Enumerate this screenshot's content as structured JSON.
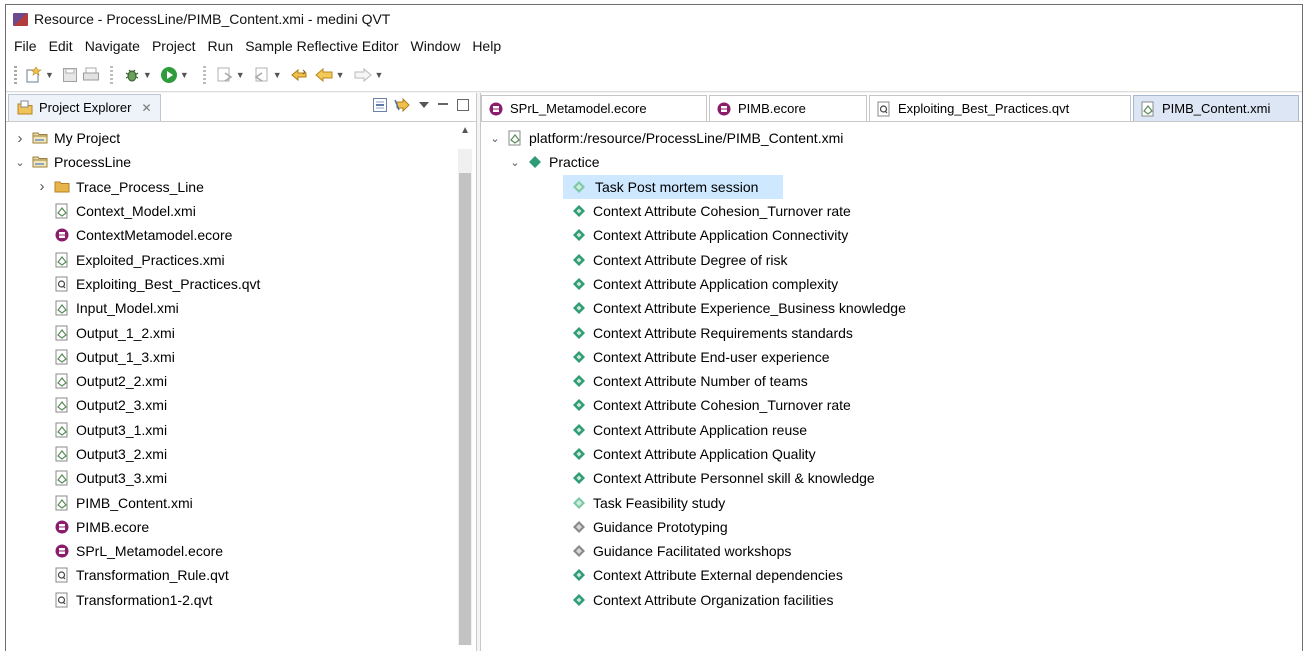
{
  "window": {
    "title": "Resource - ProcessLine/PIMB_Content.xmi - medini QVT"
  },
  "menu": [
    "File",
    "Edit",
    "Navigate",
    "Project",
    "Run",
    "Sample Reflective Editor",
    "Window",
    "Help"
  ],
  "project_explorer": {
    "tab_label": "Project Explorer",
    "tab_close": "⌥",
    "items": [
      {
        "label": "My Project",
        "type": "project",
        "expanded": false,
        "level": 0
      },
      {
        "label": "ProcessLine",
        "type": "project",
        "expanded": true,
        "level": 0
      },
      {
        "label": "Trace_Process_Line",
        "type": "folder",
        "expanded": false,
        "level": 1
      },
      {
        "label": "Context_Model.xmi",
        "type": "xmi",
        "level": 1
      },
      {
        "label": "ContextMetamodel.ecore",
        "type": "ecore",
        "level": 1
      },
      {
        "label": "Exploited_Practices.xmi",
        "type": "xmi",
        "level": 1
      },
      {
        "label": "Exploiting_Best_Practices.qvt",
        "type": "qvt",
        "level": 1
      },
      {
        "label": "Input_Model.xmi",
        "type": "xmi",
        "level": 1
      },
      {
        "label": "Output_1_2.xmi",
        "type": "xmi",
        "level": 1
      },
      {
        "label": "Output_1_3.xmi",
        "type": "xmi",
        "level": 1
      },
      {
        "label": "Output2_2.xmi",
        "type": "xmi",
        "level": 1
      },
      {
        "label": "Output2_3.xmi",
        "type": "xmi",
        "level": 1
      },
      {
        "label": "Output3_1.xmi",
        "type": "xmi",
        "level": 1
      },
      {
        "label": "Output3_2.xmi",
        "type": "xmi",
        "level": 1
      },
      {
        "label": "Output3_3.xmi",
        "type": "xmi",
        "level": 1
      },
      {
        "label": "PIMB_Content.xmi",
        "type": "xmi",
        "level": 1
      },
      {
        "label": "PIMB.ecore",
        "type": "ecore",
        "level": 1
      },
      {
        "label": "SPrL_Metamodel.ecore",
        "type": "ecore",
        "level": 1
      },
      {
        "label": "Transformation_Rule.qvt",
        "type": "qvt",
        "level": 1
      },
      {
        "label": "Transformation1-2.qvt",
        "type": "qvt",
        "level": 1
      }
    ]
  },
  "editor": {
    "tabs": [
      {
        "label": "SPrL_Metamodel.ecore",
        "type": "ecore",
        "active": false
      },
      {
        "label": "PIMB.ecore",
        "type": "ecore",
        "active": false
      },
      {
        "label": "Exploiting_Best_Practices.qvt",
        "type": "qvt",
        "active": false
      },
      {
        "label": "PIMB_Content.xmi",
        "type": "xmi",
        "active": true
      }
    ],
    "resource": "platform:/resource/ProcessLine/PIMB_Content.xmi",
    "root": "Practice",
    "children": [
      {
        "label": "Task Post mortem session",
        "kind": "task",
        "selected": true
      },
      {
        "label": "Context Attribute Cohesion_Turnover rate",
        "kind": "attr"
      },
      {
        "label": "Context Attribute Application Connectivity",
        "kind": "attr"
      },
      {
        "label": "Context Attribute Degree of risk",
        "kind": "attr"
      },
      {
        "label": "Context Attribute Application complexity",
        "kind": "attr"
      },
      {
        "label": "Context Attribute Experience_Business knowledge",
        "kind": "attr"
      },
      {
        "label": "Context Attribute Requirements standards",
        "kind": "attr"
      },
      {
        "label": "Context Attribute End-user experience",
        "kind": "attr"
      },
      {
        "label": "Context Attribute Number of teams",
        "kind": "attr"
      },
      {
        "label": "Context Attribute Cohesion_Turnover rate",
        "kind": "attr"
      },
      {
        "label": "Context Attribute Application reuse",
        "kind": "attr"
      },
      {
        "label": "Context Attribute Application Quality",
        "kind": "attr"
      },
      {
        "label": "Context Attribute Personnel skill & knowledge",
        "kind": "attr"
      },
      {
        "label": "Task Feasibility study",
        "kind": "task"
      },
      {
        "label": "Guidance Prototyping",
        "kind": "guidance"
      },
      {
        "label": "Guidance Facilitated workshops",
        "kind": "guidance"
      },
      {
        "label": "Context Attribute External dependencies",
        "kind": "attr"
      },
      {
        "label": "Context Attribute Organization facilities",
        "kind": "attr"
      }
    ]
  },
  "colors": {
    "selection": "#cde8ff",
    "active_tab": "#dce6f4",
    "folder": "#e8b54a",
    "ecore": "#8b1c6b",
    "element": "#2f9c76"
  }
}
